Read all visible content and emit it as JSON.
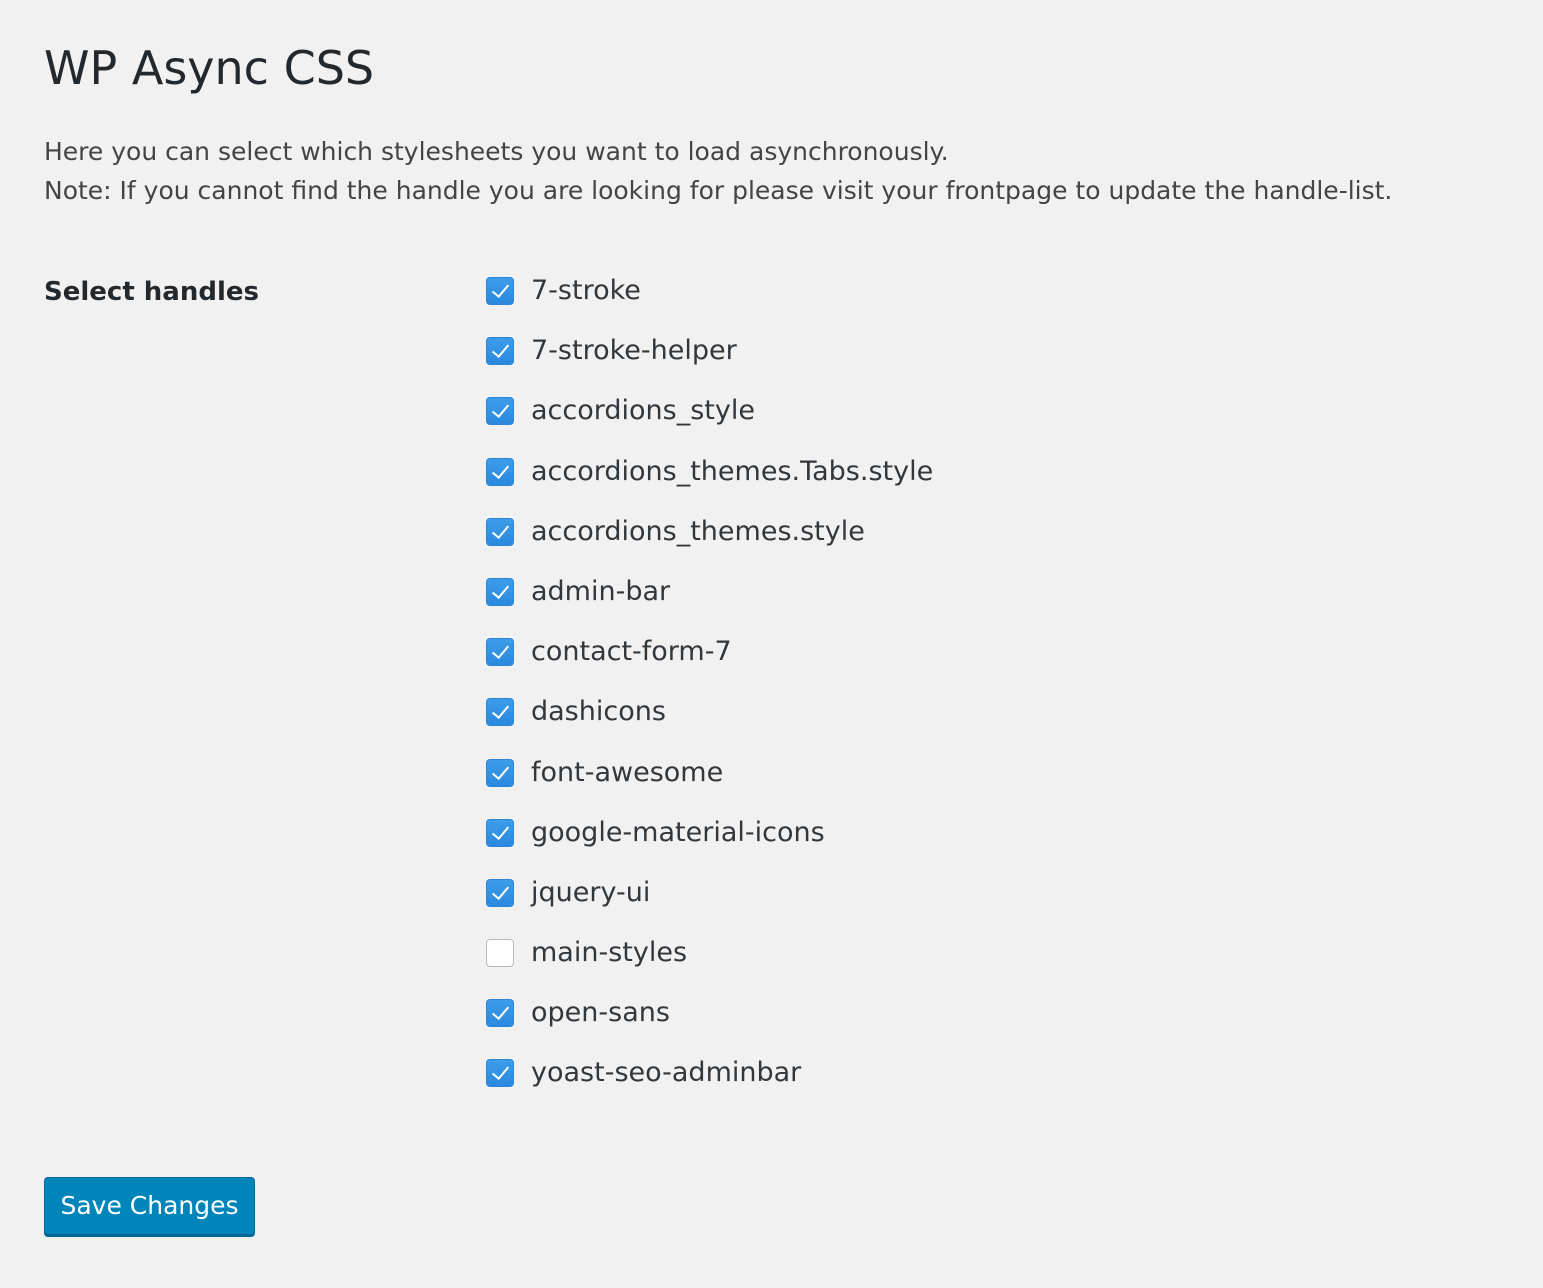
{
  "page": {
    "title": "WP Async CSS",
    "description_line1": "Here you can select which stylesheets you want to load asynchronously.",
    "description_line2": "Note: If you cannot find the handle you are looking for please visit your frontpage to update the handle-list."
  },
  "form": {
    "row_label": "Select handles",
    "handles": [
      {
        "label": "7-stroke",
        "checked": true
      },
      {
        "label": "7-stroke-helper",
        "checked": true
      },
      {
        "label": "accordions_style",
        "checked": true
      },
      {
        "label": "accordions_themes.Tabs.style",
        "checked": true
      },
      {
        "label": "accordions_themes.style",
        "checked": true
      },
      {
        "label": "admin-bar",
        "checked": true
      },
      {
        "label": "contact-form-7",
        "checked": true
      },
      {
        "label": "dashicons",
        "checked": true
      },
      {
        "label": "font-awesome",
        "checked": true
      },
      {
        "label": "google-material-icons",
        "checked": true
      },
      {
        "label": "jquery-ui",
        "checked": true
      },
      {
        "label": "main-styles",
        "checked": false
      },
      {
        "label": "open-sans",
        "checked": true
      },
      {
        "label": "yoast-seo-adminbar",
        "checked": true
      }
    ],
    "save_label": "Save Changes"
  },
  "colors": {
    "background": "#f1f1f1",
    "checkbox_checked": "#2a89de",
    "primary_button": "#0085ba"
  },
  "icons": {
    "checkbox_checked": "checkmark-icon"
  }
}
